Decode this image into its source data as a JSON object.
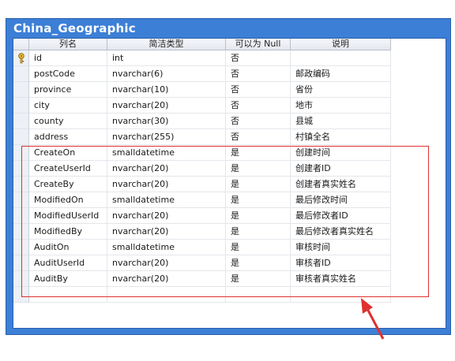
{
  "window": {
    "title": "China_Geographic"
  },
  "columns": {
    "name": "列名",
    "type": "简洁类型",
    "nullable": "可以为 Null",
    "desc": "说明"
  },
  "rows": [
    {
      "name": "id",
      "type": "int",
      "nullable": "否",
      "desc": "",
      "key": true
    },
    {
      "name": "postCode",
      "type": "nvarchar(6)",
      "nullable": "否",
      "desc": "邮政编码"
    },
    {
      "name": "province",
      "type": "nvarchar(10)",
      "nullable": "否",
      "desc": "省份"
    },
    {
      "name": "city",
      "type": "nvarchar(20)",
      "nullable": "否",
      "desc": "地市"
    },
    {
      "name": "county",
      "type": "nvarchar(30)",
      "nullable": "否",
      "desc": "县城"
    },
    {
      "name": "address",
      "type": "nvarchar(255)",
      "nullable": "否",
      "desc": "村镇全名"
    },
    {
      "name": "CreateOn",
      "type": "smalldatetime",
      "nullable": "是",
      "desc": "创建时间"
    },
    {
      "name": "CreateUserId",
      "type": "nvarchar(20)",
      "nullable": "是",
      "desc": "创建者ID"
    },
    {
      "name": "CreateBy",
      "type": "nvarchar(20)",
      "nullable": "是",
      "desc": "创建者真实姓名"
    },
    {
      "name": "ModifiedOn",
      "type": "smalldatetime",
      "nullable": "是",
      "desc": "最后修改时间"
    },
    {
      "name": "ModifiedUserId",
      "type": "nvarchar(20)",
      "nullable": "是",
      "desc": "最后修改者ID"
    },
    {
      "name": "ModifiedBy",
      "type": "nvarchar(20)",
      "nullable": "是",
      "desc": "最后修改者真实姓名"
    },
    {
      "name": "AuditOn",
      "type": "smalldatetime",
      "nullable": "是",
      "desc": "审核时间"
    },
    {
      "name": "AuditUserId",
      "type": "nvarchar(20)",
      "nullable": "是",
      "desc": "审核者ID"
    },
    {
      "name": "AuditBy",
      "type": "nvarchar(20)",
      "nullable": "是",
      "desc": "审核者真实姓名"
    },
    {
      "name": "",
      "type": "",
      "nullable": "",
      "desc": ""
    }
  ],
  "colors": {
    "frame": "#3c7fd6",
    "highlight": "#e03030"
  },
  "icons": {
    "primary_key": "key-icon",
    "annotation": "red-arrow-icon"
  }
}
